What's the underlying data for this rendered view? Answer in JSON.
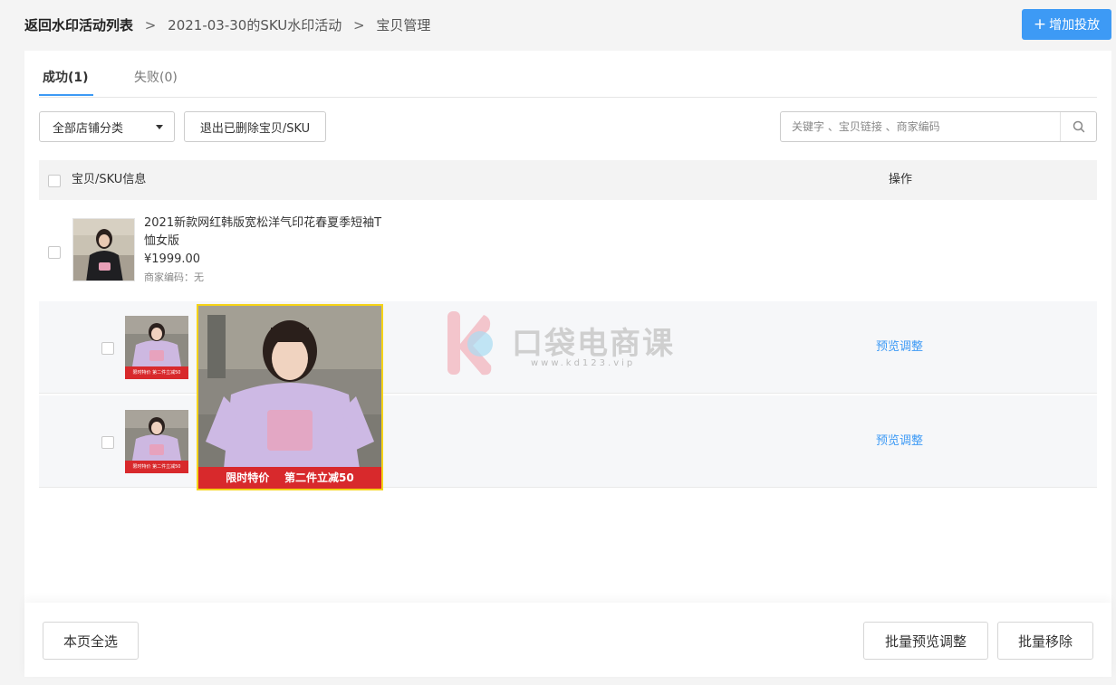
{
  "breadcrumb": {
    "root": "返回水印活动列表",
    "items": [
      "2021-03-30的SKU水印活动",
      "宝贝管理"
    ],
    "separator": ">"
  },
  "header": {
    "add_button": "增加投放",
    "add_icon": "plus-icon"
  },
  "tabs": [
    {
      "label": "成功(1)",
      "active": true
    },
    {
      "label": "失败(0)",
      "active": false
    }
  ],
  "filters": {
    "category_select": "全部店铺分类",
    "exit_deleted_button": "退出已删除宝贝/SKU",
    "search_placeholder": "关键字 、宝贝链接 、商家编码"
  },
  "table": {
    "columns": [
      "宝贝/SKU信息",
      "操作"
    ],
    "product": {
      "title": "2021新款网红韩版宽松洋气印花春夏季短袖T恤女版",
      "price": "¥1999.00",
      "merchant_code": "商家编码：无"
    },
    "sku_rows": [
      {
        "action": "预览调整"
      },
      {
        "action": "预览调整"
      }
    ]
  },
  "preview": {
    "banner": "限时特价    第二件立减50"
  },
  "sku_banner_small": "限时特价  第二件立减50",
  "watermark": {
    "text": "口袋电商课",
    "url": "www.kd123.vip"
  },
  "footer": {
    "select_page": "本页全选",
    "batch_preview": "批量预览调整",
    "batch_remove": "批量移除"
  },
  "colors": {
    "accent": "#3d9af5",
    "banner_red": "#d8292c",
    "preview_border": "#f5d317"
  }
}
